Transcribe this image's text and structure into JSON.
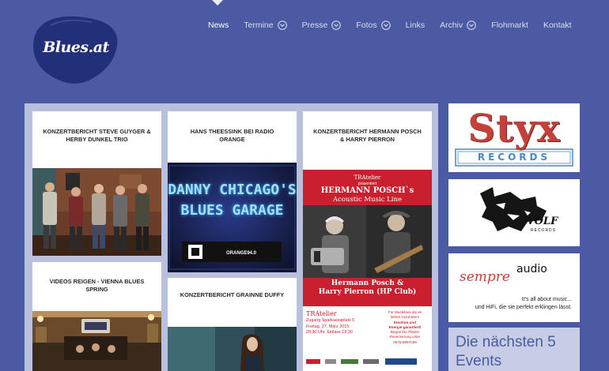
{
  "brand": {
    "logo_text": "Blues.at"
  },
  "nav": [
    {
      "label": "News",
      "active": true,
      "has_dropdown": false
    },
    {
      "label": "Termine",
      "active": false,
      "has_dropdown": true
    },
    {
      "label": "Presse",
      "active": false,
      "has_dropdown": true
    },
    {
      "label": "Fotos",
      "active": false,
      "has_dropdown": true
    },
    {
      "label": "Links",
      "active": false,
      "has_dropdown": false
    },
    {
      "label": "Archiv",
      "active": false,
      "has_dropdown": true
    },
    {
      "label": "Flohmarkt",
      "active": false,
      "has_dropdown": false
    },
    {
      "label": "Kontakt",
      "active": false,
      "has_dropdown": false
    }
  ],
  "posts": [
    {
      "title": "KONZERTBERICHT STEVE GUYGER & HERBY DUNKEL TRIO",
      "image": "band-photo"
    },
    {
      "title": "HANS THEESSINK BEI RADIO ORANGE",
      "image": "radio-poster",
      "poster_lines": [
        "DANNY CHICAGO'S",
        "BLUES GARAGE"
      ],
      "poster_footer": "ORANGE94.0"
    },
    {
      "title": "KONZERTBERICHT HERMANN POSCH & HARRY PIERRON",
      "image": "concert-flyer",
      "flyer": {
        "top": "TRAtelier",
        "sub": "präsentiert",
        "headline_1": "HERMANN POSCH`s",
        "headline_2": "Acoustic Music Line",
        "names_1": "Hermann Posch &",
        "names_2": "Harry Pierron (HP Club)",
        "venue_1": "TRAtelier",
        "venue_2": "Zugang Sparkassaplatz 5",
        "venue_3": "Freitag, 27. März 2015",
        "venue_4": "20:30 Uhr, Einlass 19:30",
        "right_1": "Für Musikfans die es",
        "right_2": "lieben zuzuhören!",
        "right_3": "Emotion und",
        "right_4": "Energie garantiert!",
        "right_5": "Begrenzte Plätze!",
        "right_6": "Reservierung unter",
        "right_7": "0676-9997099"
      }
    },
    {
      "title": "VIDEOS REIGEN - VIENNA BLUES SPRING",
      "image": "venue-photo"
    },
    {
      "title": "KONZERTBERICHT GRAINNE DUFFY",
      "image": "artist-photo"
    }
  ],
  "sidebar": {
    "ads": [
      {
        "name": "styx-records",
        "line1": "Styx",
        "line2": "RECORDS",
        "color": "#c3413a",
        "accent": "#4a87c4"
      },
      {
        "name": "wolf-records",
        "line1": "WOLF",
        "line2": "RECORDS"
      },
      {
        "name": "sempre-audio",
        "script": "sempre",
        "word": "audio",
        "tag1": "It's all about music...",
        "tag2": "und HiFi, die sie perfekt erklingen lässt."
      }
    ],
    "events_title": "Die nächsten 5 Events"
  },
  "colors": {
    "background": "#4a5ba3",
    "content_panel": "#b8c0de",
    "accent_red": "#c3413a",
    "text_dark": "#2a2a2a"
  }
}
